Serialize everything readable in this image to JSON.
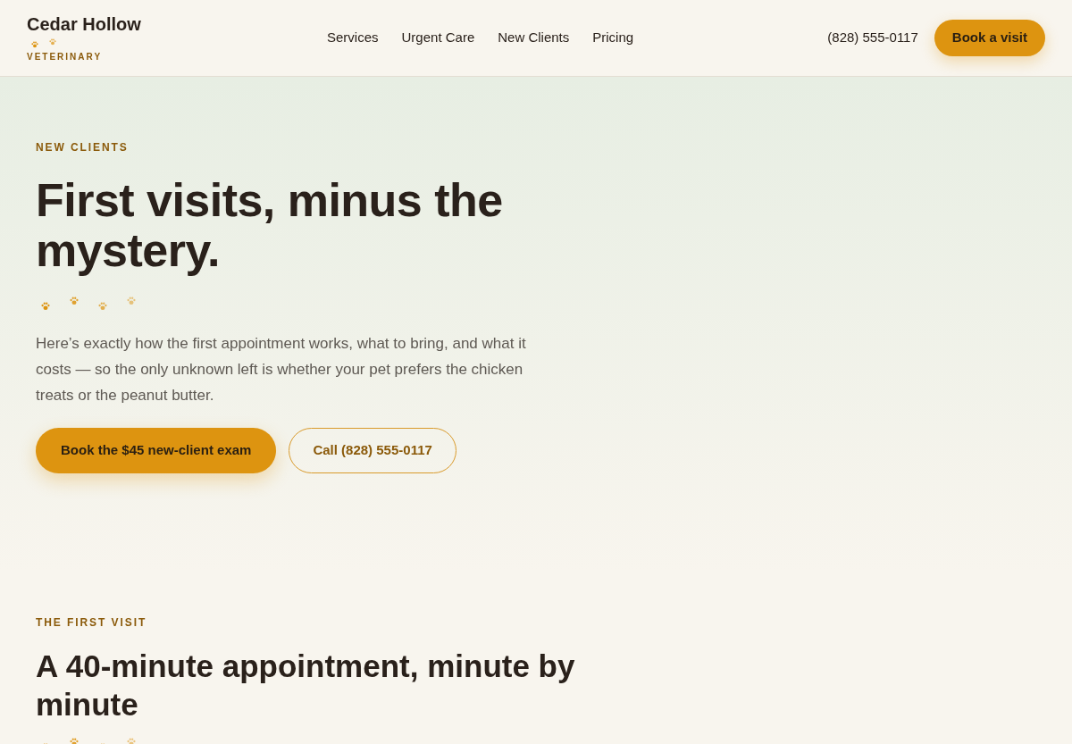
{
  "header": {
    "logo": {
      "name": "Cedar Hollow",
      "tagline": "VETERINARY"
    },
    "nav": [
      "Services",
      "Urgent Care",
      "New Clients",
      "Pricing"
    ],
    "phone": "(828) 555-0117",
    "cta": "Book a visit"
  },
  "hero": {
    "eyebrow": "NEW CLIENTS",
    "title": "First visits, minus the mystery.",
    "intro": "Here’s exactly how the first appointment works, what to bring, and what it costs — so the only unknown left is whether your pet prefers the chicken treats or the peanut butter.",
    "buttons": [
      {
        "label": "Book the $45 new-client exam",
        "kind": "primary"
      },
      {
        "label": "Call (828) 555-0117",
        "kind": "secondary"
      }
    ]
  },
  "first_visit": {
    "eyebrow": "THE FIRST VISIT",
    "title": "A 40-minute appointment, minute by minute"
  }
}
